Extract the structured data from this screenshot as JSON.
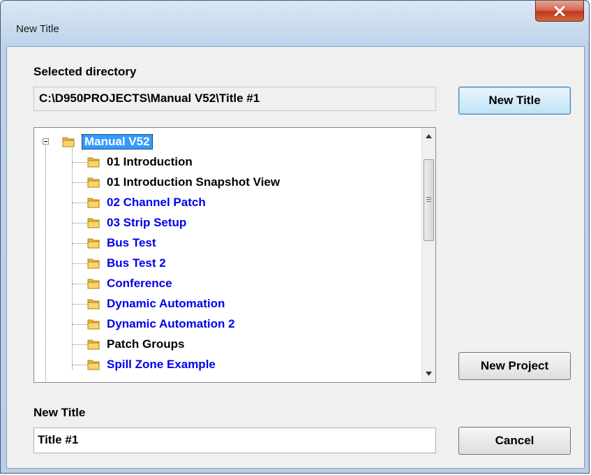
{
  "window": {
    "title": "New Title",
    "close_label": "X"
  },
  "selected_directory": {
    "label": "Selected directory",
    "path": "C:\\D950PROJECTS\\Manual V52\\Title #1"
  },
  "buttons": {
    "new_title": "New Title",
    "new_project": "New Project",
    "cancel": "Cancel"
  },
  "tree": {
    "root": {
      "label": "Manual V52",
      "expanded": true,
      "selected": true
    },
    "items": [
      {
        "label": "01 Introduction",
        "color": "#000000"
      },
      {
        "label": "01 Introduction Snapshot View",
        "color": "#000000"
      },
      {
        "label": "02 Channel Patch",
        "color": "#0000ee"
      },
      {
        "label": "03 Strip Setup",
        "color": "#0000ee"
      },
      {
        "label": "Bus Test",
        "color": "#0000ee"
      },
      {
        "label": "Bus Test 2",
        "color": "#0000ee"
      },
      {
        "label": "Conference",
        "color": "#0000ee"
      },
      {
        "label": "Dynamic Automation",
        "color": "#0000ee"
      },
      {
        "label": "Dynamic Automation 2",
        "color": "#0000ee"
      },
      {
        "label": "Patch Groups",
        "color": "#000000"
      },
      {
        "label": "Spill Zone Example",
        "color": "#0000ee"
      }
    ]
  },
  "new_title_field": {
    "label": "New Title",
    "value": "Title #1"
  },
  "icons": {
    "folder": "folder-icon",
    "close": "close-icon"
  }
}
